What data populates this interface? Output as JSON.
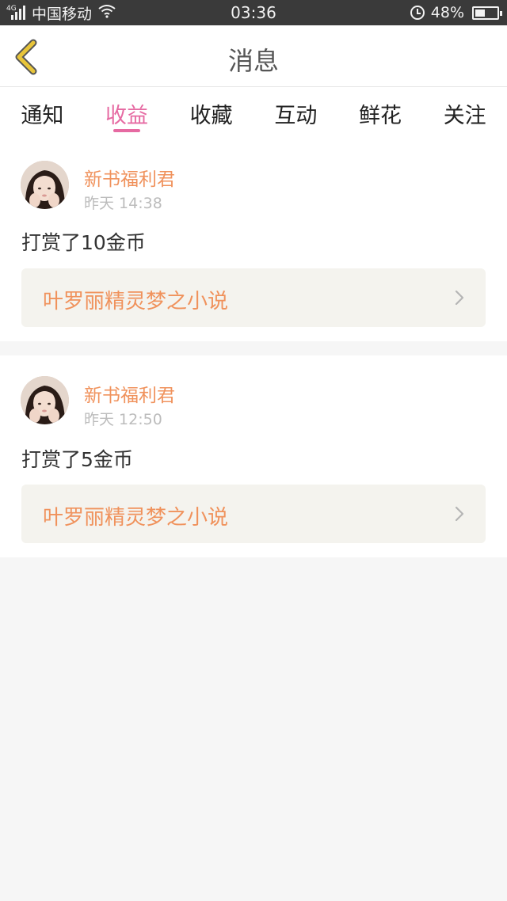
{
  "status_bar": {
    "network": "4G",
    "carrier": "中国移动",
    "time": "03:36",
    "battery": "48%",
    "battery_level": 0.48,
    "icons": [
      "signal-icon",
      "wifi-icon",
      "alarm-icon",
      "battery-icon"
    ]
  },
  "header": {
    "title": "消息",
    "back_icon": "chevron-left-icon"
  },
  "tabs": [
    {
      "label": "通知",
      "active": false
    },
    {
      "label": "收益",
      "active": true
    },
    {
      "label": "收藏",
      "active": false
    },
    {
      "label": "互动",
      "active": false
    },
    {
      "label": "鲜花",
      "active": false
    },
    {
      "label": "关注",
      "active": false
    }
  ],
  "messages": [
    {
      "user": "新书福利君",
      "time": "昨天 14:38",
      "text": "打赏了10金币",
      "book": "叶罗丽精灵梦之小说"
    },
    {
      "user": "新书福利君",
      "time": "昨天 12:50",
      "text": "打赏了5金币",
      "book": "叶罗丽精灵梦之小说"
    }
  ],
  "colors": {
    "accent": "#e66aa2",
    "highlight": "#f0925c",
    "back_icon": "#e8c53a",
    "status_bar_bg": "#3a3a3a",
    "page_bg": "#f6f6f6"
  }
}
